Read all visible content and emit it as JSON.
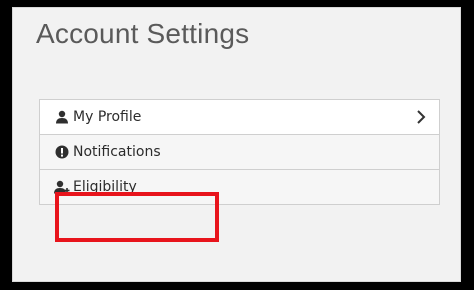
{
  "page": {
    "title": "Account Settings"
  },
  "settings": {
    "items": [
      {
        "label": "My Profile",
        "icon": "user-icon",
        "has_chevron": true
      },
      {
        "label": "Notifications",
        "icon": "exclamation-circle-icon",
        "has_chevron": false
      },
      {
        "label": "Eligibility",
        "icon": "user-plus-icon",
        "has_chevron": false,
        "highlighted": true
      }
    ]
  },
  "colors": {
    "background": "#000000",
    "panel": "#f2f2f2",
    "highlight": "#e8141c",
    "title_text": "#5a5a5a"
  }
}
